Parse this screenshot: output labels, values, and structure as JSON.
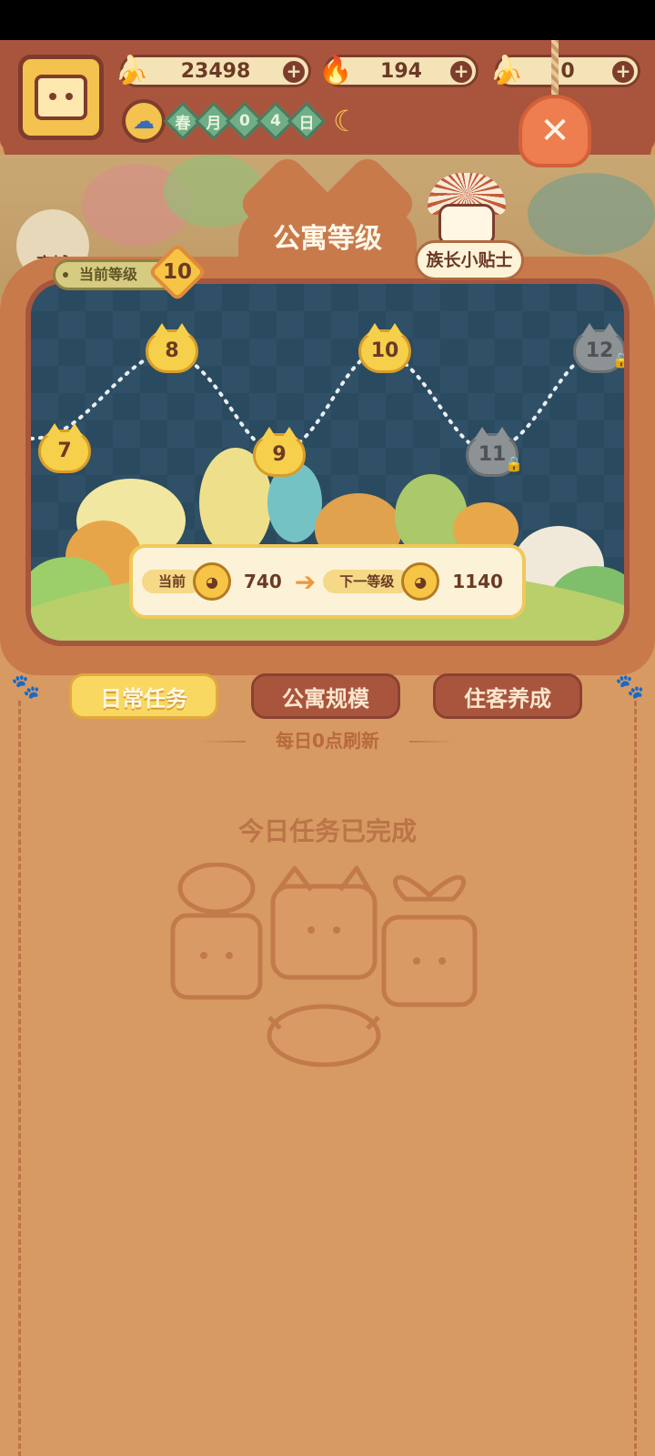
{
  "header": {
    "currencies": [
      {
        "icon": "banana-icon",
        "value": "23498"
      },
      {
        "icon": "flame-icon",
        "value": "194"
      },
      {
        "icon": "blue-banana-icon",
        "value": "0"
      }
    ],
    "date": {
      "chars": [
        "春",
        "月",
        "0",
        "4",
        "日"
      ]
    }
  },
  "shop": {
    "label": "商城"
  },
  "panel": {
    "title": "公寓等级",
    "chief_tip": "族长小贴士",
    "current_level_label": "当前等级",
    "current_level": "10"
  },
  "map": {
    "levels": [
      {
        "label": "7",
        "locked": false
      },
      {
        "label": "8",
        "locked": false
      },
      {
        "label": "9",
        "locked": false
      },
      {
        "label": "10",
        "locked": false
      },
      {
        "label": "11",
        "locked": true
      },
      {
        "label": "12",
        "locked": true
      }
    ]
  },
  "progress": {
    "current_label": "当前",
    "current_value": "740",
    "next_label": "下一等级",
    "next_value": "1140"
  },
  "tabs": [
    {
      "label": "日常任务",
      "active": true
    },
    {
      "label": "公寓规模",
      "active": false
    },
    {
      "label": "住客养成",
      "active": false
    }
  ],
  "tasks": {
    "refresh_note": "每日0点刷新",
    "empty_text": "今日任务已完成"
  },
  "colors": {
    "panel": "#c87a4b",
    "background": "#d79a62",
    "accent": "#f6c545"
  }
}
